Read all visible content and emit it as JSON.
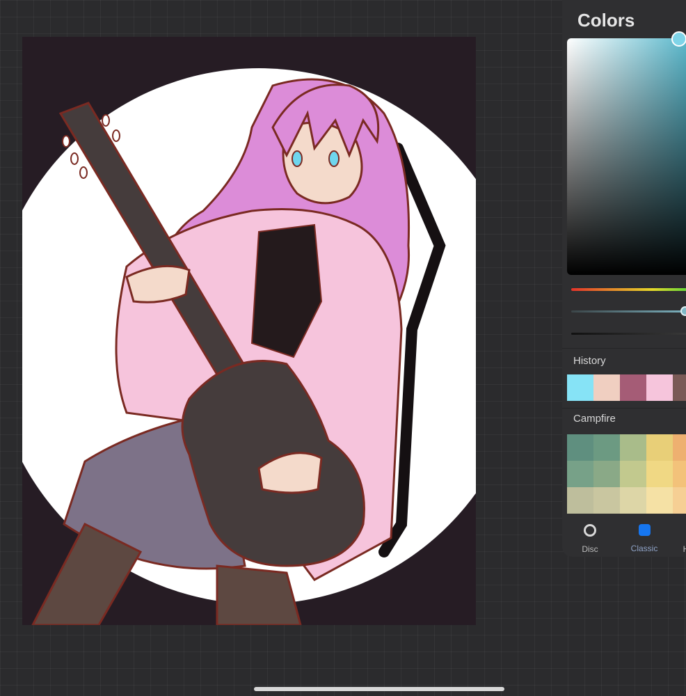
{
  "panel": {
    "title": "Colors",
    "current_color": "#7fd4e8",
    "history_label": "History",
    "history": [
      "#86e3f6",
      "#f0cfc1",
      "#a55c76",
      "#f6c5dc",
      "#7a5a56"
    ],
    "palette_label": "Campfire",
    "palette": [
      "#5f8f7f",
      "#6c9a82",
      "#a9bc8a",
      "#e8cf78",
      "#eeb070",
      "#77a188",
      "#8aa987",
      "#c2c98e",
      "#f0d884",
      "#f3c27a",
      "#bebe9c",
      "#c9c6a0",
      "#ddd6a7",
      "#f5e1a5",
      "#f6cf94"
    ],
    "modes": [
      {
        "label": "Disc",
        "icon": "circle-outline-icon"
      },
      {
        "label": "Classic",
        "icon": "square-filled-icon"
      },
      {
        "label": "H",
        "icon": "harmony-icon"
      }
    ]
  },
  "artwork": {
    "description_colors": {
      "background": "#261c24",
      "circle": "#ffffff",
      "hair": "#dc8cd8",
      "jacket": "#f6c4dc",
      "guitar": "#453c3c",
      "skirt": "#7d7288",
      "outline": "#7a2a22",
      "eyes": "#6fd6ee",
      "skin": "#f4dacb",
      "stockings": "#5d4841"
    }
  }
}
